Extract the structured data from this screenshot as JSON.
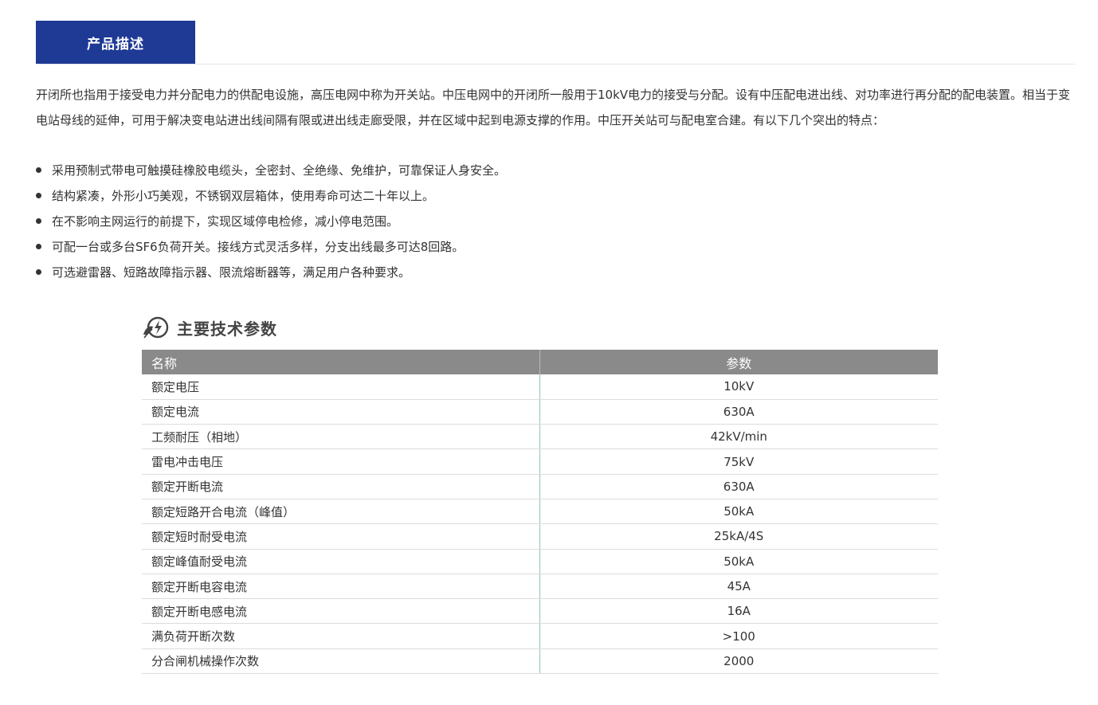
{
  "tab": {
    "label": "产品描述"
  },
  "intro": "开闭所也指用于接受电力并分配电力的供配电设施，高压电网中称为开关站。中压电网中的开闭所一般用于10kV电力的接受与分配。设有中压配电进出线、对功率进行再分配的配电装置。相当于变电站母线的延伸，可用于解决变电站进出线间隔有限或进出线走廊受限，并在区域中起到电源支撑的作用。中压开关站可与配电室合建。有以下几个突出的特点：",
  "features": [
    "采用预制式带电可触摸硅橡胶电缆头，全密封、全绝缘、免维护，可靠保证人身安全。",
    "结构紧凑，外形小巧美观，不锈钢双层箱体，使用寿命可达二十年以上。",
    "在不影响主网运行的前提下，实现区域停电检修，减小停电范围。",
    "可配一台或多台SF6负荷开关。接线方式灵活多样，分支出线最多可达8回路。",
    "可选避雷器、短路故障指示器、限流熔断器等，满足用户各种要求。"
  ],
  "section": {
    "title": "主要技术参数",
    "icon": "eco-lightning-icon"
  },
  "table": {
    "headers": {
      "name": "名称",
      "value": "参数"
    },
    "rows": [
      {
        "name": "额定电压",
        "value": "10kV"
      },
      {
        "name": "额定电流",
        "value": "630A"
      },
      {
        "name": "工频耐压（相地）",
        "value": "42kV/min"
      },
      {
        "name": "雷电冲击电压",
        "value": "75kV"
      },
      {
        "name": "额定开断电流",
        "value": "630A"
      },
      {
        "name": "额定短路开合电流（峰值）",
        "value": "50kA"
      },
      {
        "name": "额定短时耐受电流",
        "value": "25kA/4S"
      },
      {
        "name": "额定峰值耐受电流",
        "value": "50kA"
      },
      {
        "name": "额定开断电容电流",
        "value": "45A"
      },
      {
        "name": "额定开断电感电流",
        "value": "16A"
      },
      {
        "name": "满负荷开断次数",
        "value": ">100"
      },
      {
        "name": "分合闸机械操作次数",
        "value": "2000"
      }
    ]
  },
  "colors": {
    "tab_active_bg": "#1e3a95",
    "table_header_bg": "#8a8a8a",
    "divider_green": "#8fc9a8"
  }
}
